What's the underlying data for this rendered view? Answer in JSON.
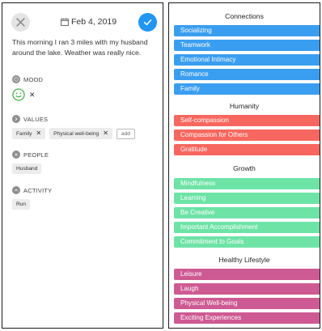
{
  "entry": {
    "date": "Feb 4, 2019",
    "text": "This morning I ran 3 miles with my husband around the lake. Weather was really nice."
  },
  "sections": {
    "mood": {
      "label": "MOOD",
      "value_icon": "smiley-face-icon"
    },
    "values": {
      "label": "VALUES",
      "chips": [
        "Family",
        "Physical well-being"
      ],
      "add_label": "add"
    },
    "people": {
      "label": "PEOPLE",
      "chips": [
        "Husband"
      ]
    },
    "activity": {
      "label": "ACTIVITY",
      "chips": [
        "Run"
      ]
    }
  },
  "groups": [
    {
      "title": "Connections",
      "color": "#3a9ef0",
      "items": [
        "Socializing",
        "Teamwork",
        "Emotional Intimacy",
        "Romance",
        "Family"
      ]
    },
    {
      "title": "Humanity",
      "color": "#f7675f",
      "items": [
        "Self-compassion",
        "Compassion for Others",
        "Gratitude"
      ]
    },
    {
      "title": "Growth",
      "color": "#6ee3a6",
      "items": [
        "Mindfulness",
        "Learning",
        "Be Creative",
        "Important Accomplishment",
        "Commitment to Goals"
      ]
    },
    {
      "title": "Healthy Lifestyle",
      "color": "#cd5a92",
      "items": [
        "Leisure",
        "Laugh",
        "Physical Well-being",
        "Exciting Experiences"
      ]
    }
  ],
  "colors": {
    "accent": "#2196f3",
    "mood_green": "#4caf50"
  }
}
